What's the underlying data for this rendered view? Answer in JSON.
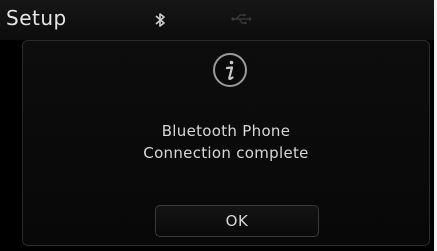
{
  "header": {
    "title": "Setup",
    "status_icons": [
      "bluetooth-icon",
      "usb-icon"
    ]
  },
  "dialog": {
    "icon": "info-icon",
    "message_line1": "Bluetooth Phone",
    "message_line2": "Connection complete",
    "ok_label": "OK"
  },
  "colors": {
    "background": "#000000",
    "text": "#d8d8d8",
    "border": "#3a3a3a"
  }
}
